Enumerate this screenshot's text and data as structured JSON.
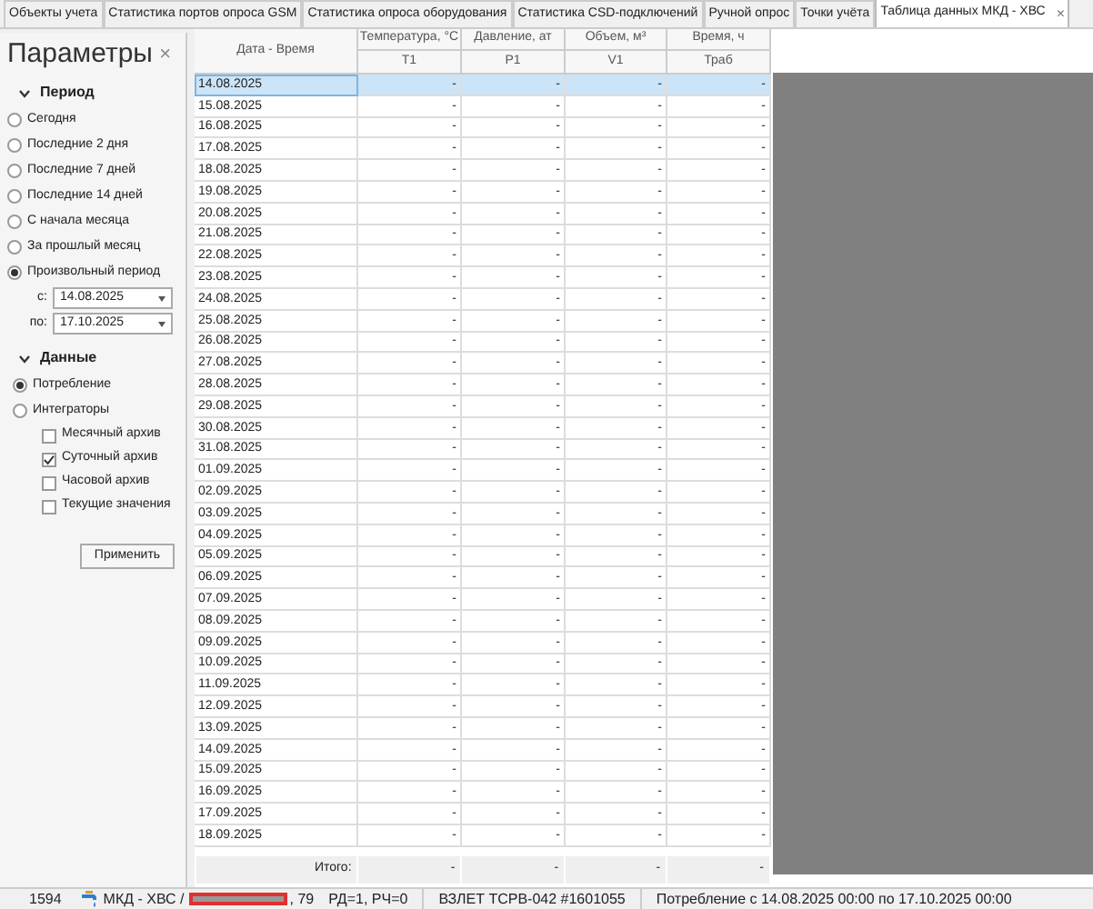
{
  "tabs": [
    {
      "label": "Объекты учета",
      "selected": false
    },
    {
      "label": "Статистика портов опроса GSM",
      "selected": false
    },
    {
      "label": "Статистика опроса оборудования",
      "selected": false
    },
    {
      "label": "Статистика CSD-подключений",
      "selected": false
    },
    {
      "label": "Ручной опрос",
      "selected": false
    },
    {
      "label": "Точки учёта",
      "selected": false
    },
    {
      "label": "Таблица данных МКД - ХВС",
      "selected": true,
      "close": "×"
    }
  ],
  "sidebar": {
    "title": "Параметры",
    "close": "×",
    "period": {
      "title": "Период",
      "expanded": true,
      "options": [
        {
          "label": "Сегодня",
          "selected": false
        },
        {
          "label": "Последние 2 дня",
          "selected": false
        },
        {
          "label": "Последние 7 дней",
          "selected": false
        },
        {
          "label": "Последние 14 дней",
          "selected": false
        },
        {
          "label": "С начала месяца",
          "selected": false
        },
        {
          "label": "За прошлый месяц",
          "selected": false
        },
        {
          "label": "Произвольный период",
          "selected": true
        }
      ],
      "from": {
        "label": "с:",
        "value": "14.08.2025"
      },
      "to": {
        "label": "по:",
        "value": "17.10.2025"
      }
    },
    "data": {
      "title": "Данные",
      "expanded": true,
      "options": [
        {
          "label": "Потребление",
          "selected": true
        },
        {
          "label": "Интеграторы",
          "selected": false
        }
      ],
      "archives": [
        {
          "label": "Месячный архив",
          "checked": false
        },
        {
          "label": "Суточный архив",
          "checked": true
        },
        {
          "label": "Часовой архив",
          "checked": false
        },
        {
          "label": "Текущие значения",
          "checked": false
        }
      ]
    },
    "apply_button": "Применить"
  },
  "table": {
    "columns": [
      {
        "title": "Дата - Время"
      },
      {
        "title": "Температура, °C",
        "sub": "T1"
      },
      {
        "title": "Давление, ат",
        "sub": "P1"
      },
      {
        "title": "Объем, м³",
        "sub": "V1"
      },
      {
        "title": "Время, ч",
        "sub": "Траб"
      }
    ],
    "rows": [
      {
        "date": "14.08.2025",
        "values": [
          "-",
          "-",
          "-",
          "-"
        ],
        "selected": true
      },
      {
        "date": "15.08.2025",
        "values": [
          "-",
          "-",
          "-",
          "-"
        ],
        "selected": false
      },
      {
        "date": "16.08.2025",
        "values": [
          "-",
          "-",
          "-",
          "-"
        ],
        "selected": false
      },
      {
        "date": "17.08.2025",
        "values": [
          "-",
          "-",
          "-",
          "-"
        ],
        "selected": false
      },
      {
        "date": "18.08.2025",
        "values": [
          "-",
          "-",
          "-",
          "-"
        ],
        "selected": false
      },
      {
        "date": "19.08.2025",
        "values": [
          "-",
          "-",
          "-",
          "-"
        ],
        "selected": false
      },
      {
        "date": "20.08.2025",
        "values": [
          "-",
          "-",
          "-",
          "-"
        ],
        "selected": false
      },
      {
        "date": "21.08.2025",
        "values": [
          "-",
          "-",
          "-",
          "-"
        ],
        "selected": false
      },
      {
        "date": "22.08.2025",
        "values": [
          "-",
          "-",
          "-",
          "-"
        ],
        "selected": false
      },
      {
        "date": "23.08.2025",
        "values": [
          "-",
          "-",
          "-",
          "-"
        ],
        "selected": false
      },
      {
        "date": "24.08.2025",
        "values": [
          "-",
          "-",
          "-",
          "-"
        ],
        "selected": false
      },
      {
        "date": "25.08.2025",
        "values": [
          "-",
          "-",
          "-",
          "-"
        ],
        "selected": false
      },
      {
        "date": "26.08.2025",
        "values": [
          "-",
          "-",
          "-",
          "-"
        ],
        "selected": false
      },
      {
        "date": "27.08.2025",
        "values": [
          "-",
          "-",
          "-",
          "-"
        ],
        "selected": false
      },
      {
        "date": "28.08.2025",
        "values": [
          "-",
          "-",
          "-",
          "-"
        ],
        "selected": false
      },
      {
        "date": "29.08.2025",
        "values": [
          "-",
          "-",
          "-",
          "-"
        ],
        "selected": false
      },
      {
        "date": "30.08.2025",
        "values": [
          "-",
          "-",
          "-",
          "-"
        ],
        "selected": false
      },
      {
        "date": "31.08.2025",
        "values": [
          "-",
          "-",
          "-",
          "-"
        ],
        "selected": false
      },
      {
        "date": "01.09.2025",
        "values": [
          "-",
          "-",
          "-",
          "-"
        ],
        "selected": false
      },
      {
        "date": "02.09.2025",
        "values": [
          "-",
          "-",
          "-",
          "-"
        ],
        "selected": false
      },
      {
        "date": "03.09.2025",
        "values": [
          "-",
          "-",
          "-",
          "-"
        ],
        "selected": false
      },
      {
        "date": "04.09.2025",
        "values": [
          "-",
          "-",
          "-",
          "-"
        ],
        "selected": false
      },
      {
        "date": "05.09.2025",
        "values": [
          "-",
          "-",
          "-",
          "-"
        ],
        "selected": false
      },
      {
        "date": "06.09.2025",
        "values": [
          "-",
          "-",
          "-",
          "-"
        ],
        "selected": false
      },
      {
        "date": "07.09.2025",
        "values": [
          "-",
          "-",
          "-",
          "-"
        ],
        "selected": false
      },
      {
        "date": "08.09.2025",
        "values": [
          "-",
          "-",
          "-",
          "-"
        ],
        "selected": false
      },
      {
        "date": "09.09.2025",
        "values": [
          "-",
          "-",
          "-",
          "-"
        ],
        "selected": false
      },
      {
        "date": "10.09.2025",
        "values": [
          "-",
          "-",
          "-",
          "-"
        ],
        "selected": false
      },
      {
        "date": "11.09.2025",
        "values": [
          "-",
          "-",
          "-",
          "-"
        ],
        "selected": false
      },
      {
        "date": "12.09.2025",
        "values": [
          "-",
          "-",
          "-",
          "-"
        ],
        "selected": false
      },
      {
        "date": "13.09.2025",
        "values": [
          "-",
          "-",
          "-",
          "-"
        ],
        "selected": false
      },
      {
        "date": "14.09.2025",
        "values": [
          "-",
          "-",
          "-",
          "-"
        ],
        "selected": false
      },
      {
        "date": "15.09.2025",
        "values": [
          "-",
          "-",
          "-",
          "-"
        ],
        "selected": false
      },
      {
        "date": "16.09.2025",
        "values": [
          "-",
          "-",
          "-",
          "-"
        ],
        "selected": false
      },
      {
        "date": "17.09.2025",
        "values": [
          "-",
          "-",
          "-",
          "-"
        ],
        "selected": false
      },
      {
        "date": "18.09.2025",
        "values": [
          "-",
          "-",
          "-",
          "-"
        ],
        "selected": false
      }
    ],
    "totals": {
      "label": "Итого:",
      "values": [
        "-",
        "-",
        "-",
        "-"
      ]
    }
  },
  "status_bar": {
    "id": "1594",
    "object": "МКД - ХВС /",
    "suffix": ", 79",
    "flags": "РД=1, РЧ=0",
    "device": "ВЗЛЕТ ТСРВ-042 #1601055",
    "period": "Потребление с 14.08.2025 00:00 по 17.10.2025 00:00"
  }
}
